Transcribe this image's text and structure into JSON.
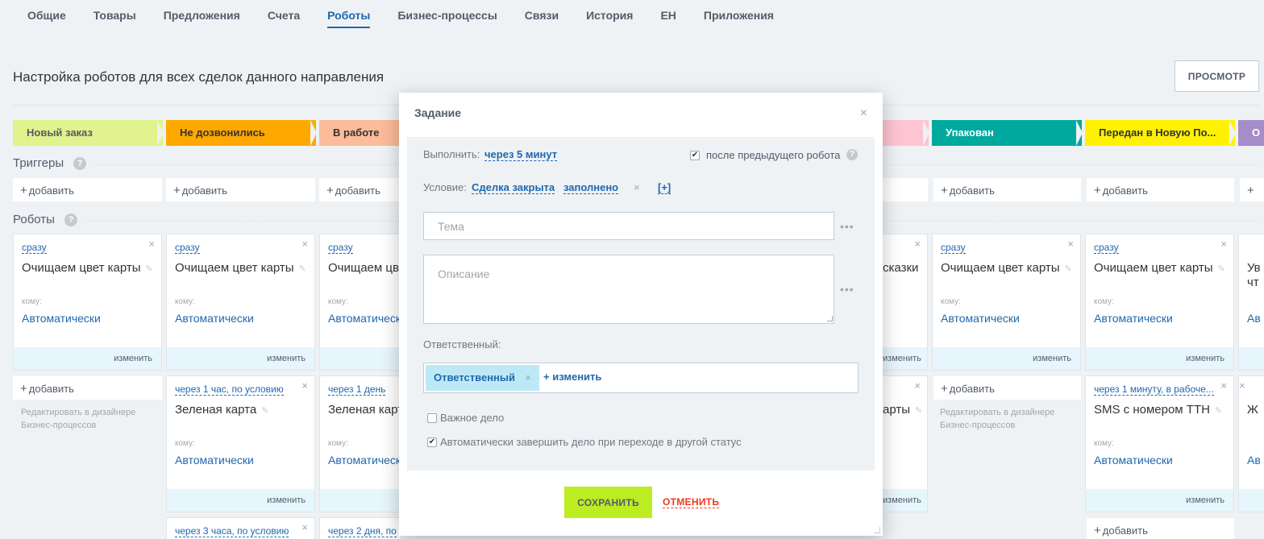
{
  "tabs": [
    "Общие",
    "Товары",
    "Предложения",
    "Счета",
    "Роботы",
    "Бизнес-процессы",
    "Связи",
    "История",
    "ЕН",
    "Приложения"
  ],
  "page": {
    "title": "Настройка роботов для всех сделок данного направления",
    "preview_label": "ПРОСМОТР"
  },
  "stages": [
    {
      "label": "Новый заказ",
      "color": "#e2f28c",
      "text_color": "#535c69"
    },
    {
      "label": "Не дозвонились",
      "color": "#ffa900",
      "text_color": "#333333"
    },
    {
      "label": "В работе",
      "color": "#fcbb9a",
      "text_color": "#333333"
    },
    {
      "label": "",
      "color": "#ffc4d1",
      "text_color": "#333333"
    },
    {
      "label": "Упакован",
      "color": "#00a99d",
      "text_color": "#ffffff"
    },
    {
      "label": "Передан в Новую По...",
      "color": "#fff200",
      "text_color": "#333333"
    },
    {
      "label": "О",
      "color": "#a58dc9",
      "text_color": "#ffffff"
    }
  ],
  "sections": {
    "triggers": "Триггеры",
    "robots": "Роботы",
    "help": "?"
  },
  "common": {
    "add": "добавить",
    "plus": "+",
    "change": "изменить",
    "komu": "кому:",
    "auto": "Автоматически",
    "close": "×",
    "pencil": "✎",
    "designer_note_1": "Редактировать в дизайнере",
    "designer_note_2": "Бизнес-процессов"
  },
  "cards": {
    "c1": {
      "timing": "сразу",
      "name": "Очищаем цвет карты"
    },
    "c2": {
      "timing": "сразу",
      "name": "Очищаем цвет карты"
    },
    "c3": {
      "timing": "сразу",
      "name": "Очищаем цв"
    },
    "c4": {
      "name": "сказки"
    },
    "c5": {
      "timing": "сразу",
      "name": "Очищаем цвет карты"
    },
    "c6": {
      "timing": "сразу",
      "name": "Очищаем цвет карты"
    },
    "c7": {
      "name": "Ув",
      "name2": "чт",
      "resp": "Ав"
    },
    "d2": {
      "timing": "через 1 час, по условию",
      "name": "Зеленая карта"
    },
    "d3": {
      "timing": "через 1 день",
      "name": "Зеленая карт"
    },
    "d4": {
      "name": "арты"
    },
    "d6": {
      "timing": "через 1 минуту, в рабоче...",
      "name": "SMS с номером ТТН"
    },
    "d7": {
      "name": "Ж",
      "resp": "Ав"
    },
    "e2": {
      "timing": "через 3 часа, по условию"
    },
    "e3": {
      "timing": "через 2 дня, по"
    }
  },
  "modal": {
    "title": "Задание",
    "execute_label": "Выполнить:",
    "execute_value": "через 5 минут",
    "after_prev_label": "после предыдущего робота",
    "after_prev_checked": true,
    "condition_label": "Условие:",
    "condition_field": "Сделка закрыта",
    "condition_value": "заполнено",
    "condition_add": "[+]",
    "topic_placeholder": "Тема",
    "description_placeholder": "Описание",
    "dots": "•••",
    "responsible_label": "Ответственный:",
    "responsible_tag": "Ответственный",
    "responsible_change": "изменить",
    "important_label": "Важное дело",
    "important_checked": false,
    "autocomplete_label": "Автоматически завершить дело при переходе в другой статус",
    "autocomplete_checked": true,
    "save_label": "СОХРАНИТЬ",
    "cancel_label": "ОТМЕНИТЬ"
  }
}
